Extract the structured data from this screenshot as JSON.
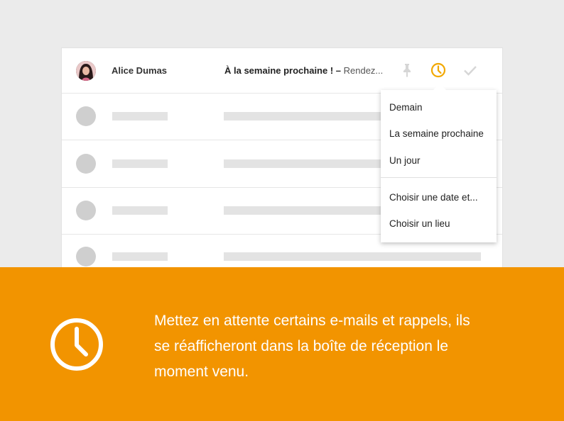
{
  "email_list": {
    "first_row": {
      "sender": "Alice Dumas",
      "subject": "À la semaine prochaine ! –",
      "snippet": " Rendez..."
    },
    "placeholder_rows": 4
  },
  "row_actions": {
    "pin_icon": "pin-icon",
    "snooze_icon": "clock-icon",
    "done_icon": "check-icon"
  },
  "snooze_menu": {
    "items": [
      "Demain",
      "La semaine prochaine",
      "Un jour"
    ],
    "custom_items": [
      "Choisir une date et...",
      "Choisir un lieu"
    ]
  },
  "banner": {
    "icon": "clock-icon",
    "text": "Mettez en attente certains e-mails et rappels, ils se réafficheront dans la boîte de réception le moment venu."
  },
  "colors": {
    "accent": "#f29400",
    "snooze_icon": "#f2a800",
    "background": "#ebebeb",
    "placeholder": "#e3e3e3"
  }
}
